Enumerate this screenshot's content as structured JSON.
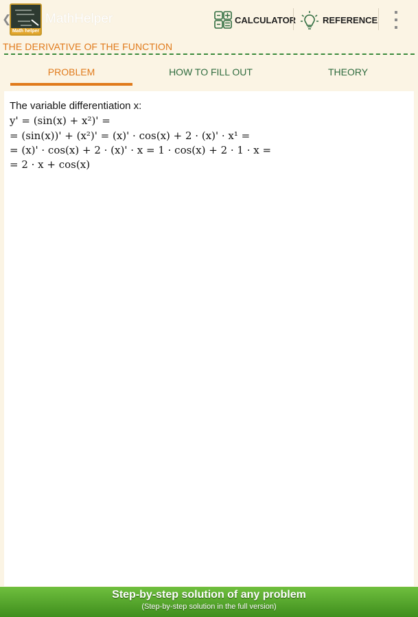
{
  "app": {
    "title": "MathHelper",
    "logo_tag": "Math helper"
  },
  "actions": {
    "calculator": "CALCULATOR",
    "reference": "REFERENCE"
  },
  "section_title": "THE DERIVATIVE OF THE FUNCTION",
  "tabs": [
    {
      "label": "PROBLEM",
      "active": true
    },
    {
      "label": "HOW TO FILL OUT",
      "active": false
    },
    {
      "label": "THEORY",
      "active": false
    }
  ],
  "solution": {
    "lead": "The variable differentiation x:",
    "lines": [
      "y' = (sin(x) + x²)' =",
      "= (sin(x))' + (x²)' = (x)' · cos(x) + 2 · (x)' · x¹ =",
      "= (x)' · cos(x) + 2 · (x)' · x = 1 · cos(x) + 2 · 1 · x =",
      "= 2 · x + cos(x)"
    ]
  },
  "banner": {
    "title": "Step-by-step solution of any problem",
    "subtitle": "(Step-by-step solution in the full version)"
  },
  "colors": {
    "accent": "#e07a1b",
    "tab_text": "#2e6b3e",
    "dashes": "#3a8a3a",
    "banner_green": "#4f9f27"
  },
  "icons": [
    "back-chevron-icon",
    "calculator-icon",
    "lightbulb-icon",
    "overflow-menu-icon"
  ]
}
